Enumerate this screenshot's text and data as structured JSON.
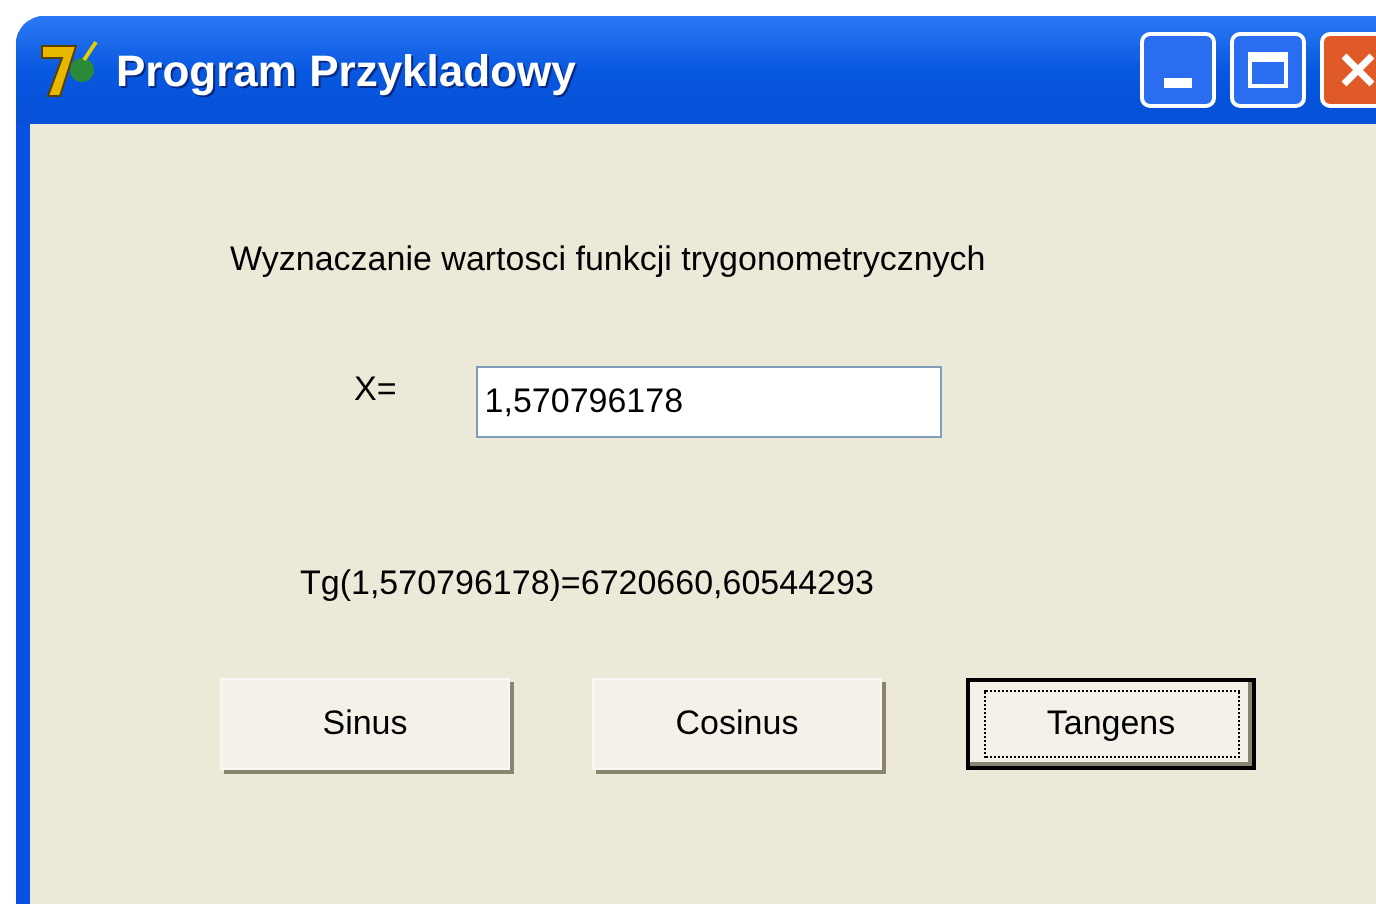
{
  "window": {
    "title": "Program Przykladowy"
  },
  "heading": "Wyznaczanie wartosci funkcji trygonometrycznych",
  "x_label": "X=",
  "x_field": {
    "value": "1,570796178"
  },
  "result": "Tg(1,570796178)=6720660,60544293",
  "buttons": [
    {
      "label": "Sinus",
      "focused": false
    },
    {
      "label": "Cosinus",
      "focused": false
    },
    {
      "label": "Tangens",
      "focused": true
    }
  ]
}
